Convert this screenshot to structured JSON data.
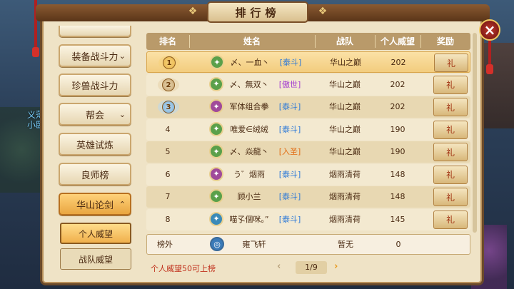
{
  "window": {
    "title": "排行榜",
    "close_icon": "×"
  },
  "sidebar_bg": {
    "line1": "义薄",
    "line2": "小卧龙"
  },
  "menu": {
    "items": [
      {
        "label": "装备战斗力",
        "chev": "⌄"
      },
      {
        "label": "珍兽战斗力",
        "chev": ""
      },
      {
        "label": "帮会",
        "chev": "⌄"
      },
      {
        "label": "英雄试炼",
        "chev": ""
      },
      {
        "label": "良师榜",
        "chev": ""
      },
      {
        "label": "华山论剑",
        "chev": "⌃"
      }
    ],
    "sub_items": [
      {
        "label": "个人威望"
      },
      {
        "label": "战队威望"
      }
    ]
  },
  "table": {
    "headers": {
      "rank": "排名",
      "name": "姓名",
      "team": "战队",
      "prestige": "个人威望",
      "reward": "奖励"
    },
    "rows": [
      {
        "rank": "1",
        "name": "〆、一血丶",
        "title": "[泰斗]",
        "team": "华山之巅",
        "prestige": "202",
        "reward_icon": "礼"
      },
      {
        "rank": "2",
        "name": "〆、無双丶",
        "title": "[傲世]",
        "team": "华山之巅",
        "prestige": "202",
        "reward_icon": "礼"
      },
      {
        "rank": "3",
        "name": "军体组合拳",
        "title": "[泰斗]",
        "team": "华山之巅",
        "prestige": "202",
        "reward_icon": "礼"
      },
      {
        "rank": "4",
        "name": "唯爱∈绒绒",
        "title": "[泰斗]",
        "team": "华山之巅",
        "prestige": "190",
        "reward_icon": "礼"
      },
      {
        "rank": "5",
        "name": "〆、焱龍丶",
        "title": "[入圣]",
        "team": "华山之巅",
        "prestige": "190",
        "reward_icon": "礼"
      },
      {
        "rank": "6",
        "name": "う゛烟雨",
        "title": "[泰斗]",
        "team": "烟雨清荷",
        "prestige": "148",
        "reward_icon": "礼"
      },
      {
        "rank": "7",
        "name": "顾小兰",
        "title": "[泰斗]",
        "team": "烟雨清荷",
        "prestige": "148",
        "reward_icon": "礼"
      },
      {
        "rank": "8",
        "name": "喵孓個咪。”",
        "title": "[泰斗]",
        "team": "烟雨清荷",
        "prestige": "145",
        "reward_icon": "礼"
      }
    ],
    "title_colors": {
      "[泰斗]": "#2a78d8",
      "[傲世]": "#a23ad0",
      "[入圣]": "#e26a10"
    }
  },
  "self_row": {
    "rank": "榜外",
    "name": "雍飞轩",
    "team": "暂无",
    "prestige": "0"
  },
  "footer": {
    "note": "个人威望50可上榜",
    "page": "1/9",
    "prev": "‹",
    "next": "›"
  },
  "colors": {
    "accent": "#c0301c",
    "highlight": "#f2cc7e"
  }
}
